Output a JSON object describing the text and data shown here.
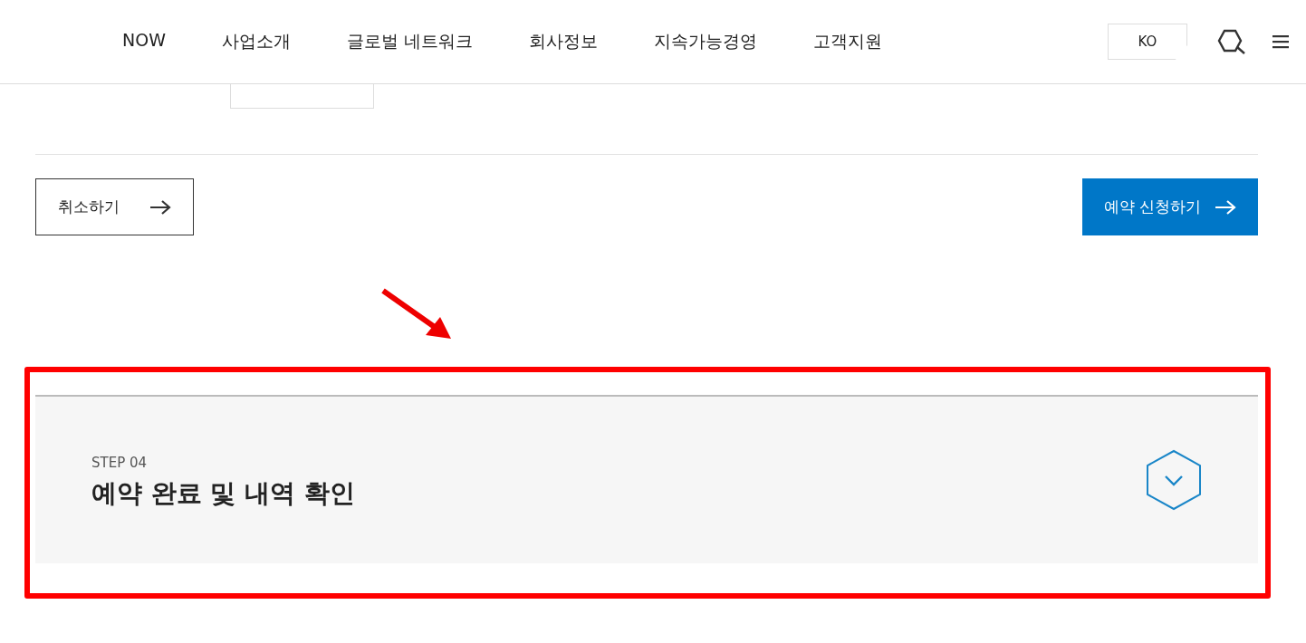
{
  "nav": {
    "items": [
      {
        "label": "NOW"
      },
      {
        "label": "사업소개"
      },
      {
        "label": "글로벌 네트워크"
      },
      {
        "label": "회사정보"
      },
      {
        "label": "지속가능경영"
      },
      {
        "label": "고객지원"
      }
    ],
    "language": "KO"
  },
  "form": {
    "cancel_button": "취소하기",
    "submit_button": "예약 신청하기"
  },
  "step": {
    "label": "STEP 04",
    "title": "예약 완료 및 내역 확인",
    "expanded": false
  }
}
